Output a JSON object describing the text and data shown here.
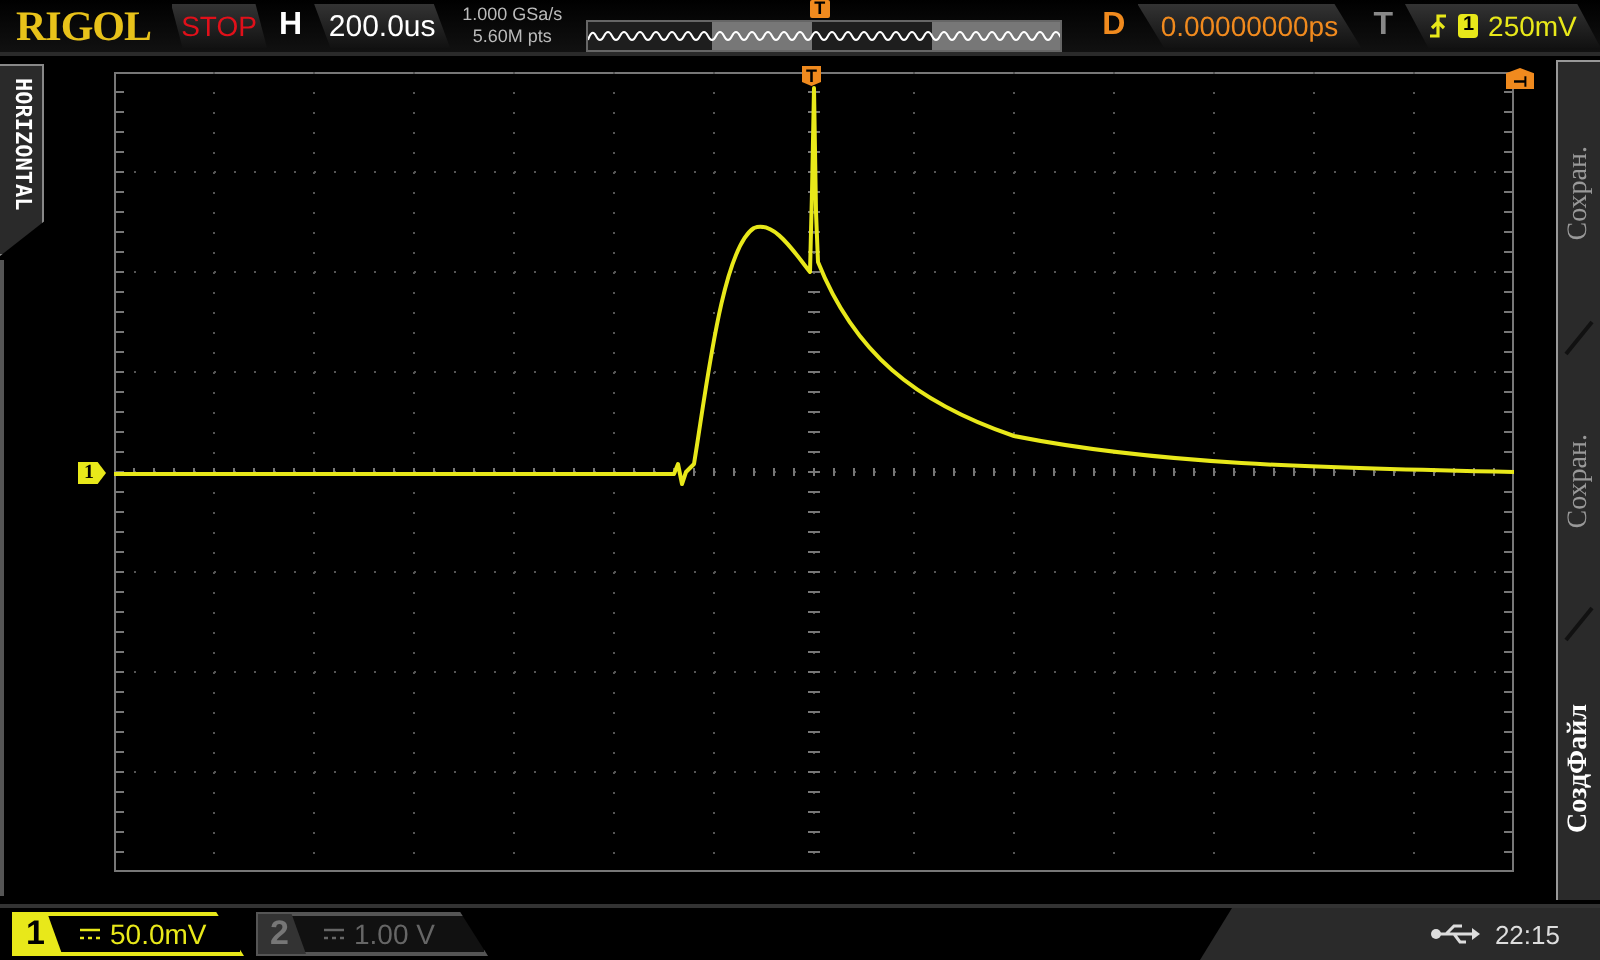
{
  "brand": "RIGOL",
  "run_state": "STOP",
  "horizontal": {
    "label": "H",
    "timebase": "200.0us"
  },
  "acquisition": {
    "sample_rate": "1.000 GSa/s",
    "memory_depth": "5.60M pts"
  },
  "memory_bar": {
    "trigger_marker": "T"
  },
  "delay": {
    "label": "D",
    "value": "0.00000000ps"
  },
  "trigger": {
    "label": "T",
    "source": "1",
    "level": "250mV"
  },
  "side_tab": "HORIZONTAL",
  "screen": {
    "trigger_position_marker": "T",
    "trigger_level_marker": "T",
    "channel_marker": "1"
  },
  "menu": [
    {
      "label": "Сохран.",
      "selected": false
    },
    {
      "label": "Сохран.",
      "selected": false
    },
    {
      "label": "СоздФайл",
      "selected": true
    }
  ],
  "channels": [
    {
      "number": "1",
      "scale": "50.0mV",
      "on": true
    },
    {
      "number": "2",
      "scale": "1.00 V",
      "on": false
    }
  ],
  "status": {
    "time": "22:15"
  }
}
